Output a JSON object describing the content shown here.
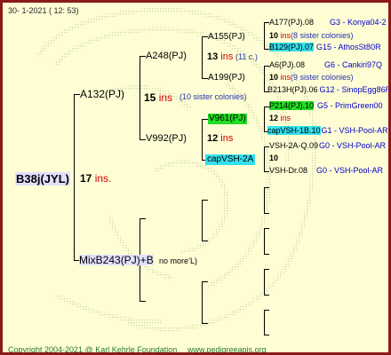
{
  "header": {
    "date": "30-   1-2021  ( 12:  53)"
  },
  "footer": {
    "copyright": "Copyright 2004-2021 @ Karl Kehrle Foundation",
    "url": "www.pedigreeapis.org"
  },
  "root": {
    "name": "B38j(JYL)",
    "num": "17",
    "ins": " ins."
  },
  "gen1": {
    "sire": {
      "name": "A132(PJ)",
      "num": "15",
      "ins": " ins",
      "note": "(10 sister colonies)"
    },
    "dam": {
      "name": "MixB243(PJ)+B",
      "note": "no more’L)"
    }
  },
  "gen2": {
    "a248": {
      "name": "A248(PJ)",
      "num": "13",
      "ins": " ins",
      "note": "(11 c.)"
    },
    "v992": {
      "name": "V992(PJ)",
      "num": "12",
      "ins": " ins"
    }
  },
  "gen3": {
    "a155": "A155(PJ)",
    "a199": "A199(PJ)",
    "v961": "V961(PJ)",
    "vsh2a": "capVSH-2A"
  },
  "gen4": [
    {
      "name": "A177(PJ).08",
      "info": "G3 - Konya04-2"
    },
    {
      "num": "10",
      "ins": " ins",
      "note": "(8 sister colonies)"
    },
    {
      "name": "B129(PJ).07",
      "info": "G15 - AthosSt80R"
    },
    {
      "name": "A6(PJ).08",
      "info": "G6 - Cankiri97Q"
    },
    {
      "num": "10",
      "ins": " ins",
      "note": "(9 sister colonies)"
    },
    {
      "name": "B213H(PJ).06",
      "info": "G12 - SinopEgg86R"
    },
    {
      "name": "P214(PJ).10",
      "info": "G5 - PrimGreen00"
    },
    {
      "num": "12",
      "ins": " ins"
    },
    {
      "name": "capVSH-1B.10",
      "info": "G1 - VSH-Pool-AR"
    },
    {
      "name": "VSH-2A-Q.09",
      "info": "G0 - VSH-Pool-AR"
    },
    {
      "num": "10"
    },
    {
      "name": "VSH-Dr.08",
      "info": "G0 - VSH-Pool-AR"
    }
  ]
}
